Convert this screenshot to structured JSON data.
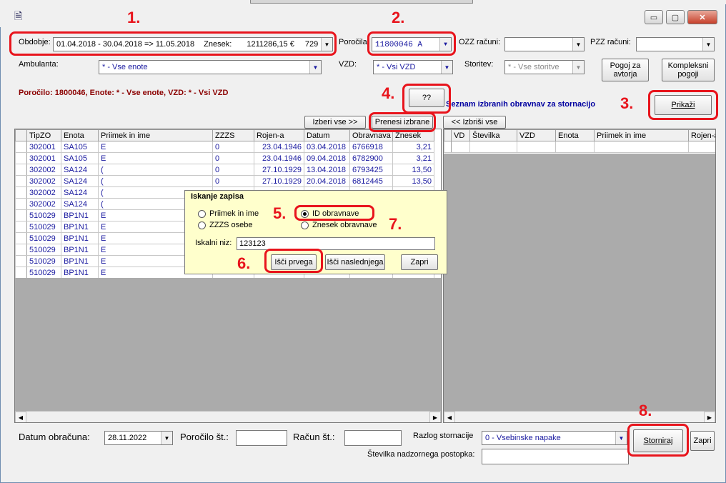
{
  "window": {
    "minimize": "▭",
    "maximize": "▢",
    "close": "✕",
    "app_icon": "report-icon"
  },
  "filters": {
    "obdobje_label": "Obdobje:",
    "obdobje_value": "01.04.2018 - 30.04.2018 => 11.05.2018",
    "znesek_label": "Znesek:",
    "znesek_value": "1211286,15 €",
    "znesek_count": "729",
    "porocilo_label": "Poročila",
    "porocilo_value": "11800046 A",
    "ozz_label": "OZZ računi:",
    "pzz_label": "PZZ računi:",
    "ambulanta_label": "Ambulanta:",
    "ambulanta_value": "*  - Vse enote",
    "vzd_label": "VZD:",
    "vzd_value": "*  - Vsi VZD",
    "storitev_label": "Storitev:",
    "storitev_value": "*  - Vse storitve",
    "pogoj_avtorja": "Pogoj za avtorja",
    "kompleksni_pogoji": "Kompleksni pogoji"
  },
  "status_text": "Poročilo: 1800046, Enote: *  - Vse enote, VZD: *  - Vsi VZD",
  "search_button": "??",
  "list_title": "Seznam  izbranih obravnav za stornacijo",
  "prikazi": "Prikaži",
  "izberi_vse": "Izberi vse >>",
  "prenesi_izbrane": "Prenesi izbrane",
  "izbrisi_vse": "<< Izbriši vse",
  "left_table": {
    "headers": [
      "TipZO",
      "Enota",
      "Priimek in ime",
      "ZZZS",
      "Rojen-a",
      "Datum",
      "Obravnava",
      "Znesek"
    ],
    "rows": [
      [
        "302001",
        "SA105",
        "E",
        "0",
        "23.04.1946",
        "03.04.2018",
        "6766918",
        "3,21"
      ],
      [
        "302001",
        "SA105",
        "E",
        "0",
        "23.04.1946",
        "09.04.2018",
        "6782900",
        "3,21"
      ],
      [
        "302002",
        "SA124",
        "(",
        "0",
        "27.10.1929",
        "13.04.2018",
        "6793425",
        "13,50"
      ],
      [
        "302002",
        "SA124",
        "(",
        "0",
        "27.10.1929",
        "20.04.2018",
        "6812445",
        "13,50"
      ],
      [
        "302002",
        "SA124",
        "(",
        "",
        "",
        "",
        "",
        ""
      ],
      [
        "302002",
        "SA124",
        "(",
        "",
        "",
        "",
        "",
        ""
      ],
      [
        "510029",
        "BP1N1",
        "E",
        "",
        "",
        "",
        "",
        ""
      ],
      [
        "510029",
        "BP1N1",
        "E",
        "",
        "",
        "",
        "",
        ""
      ],
      [
        "510029",
        "BP1N1",
        "E",
        "",
        "",
        "",
        "",
        ""
      ],
      [
        "510029",
        "BP1N1",
        "E",
        "",
        "",
        "",
        "",
        ""
      ],
      [
        "510029",
        "BP1N1",
        "E",
        "",
        "",
        "",
        "",
        ""
      ],
      [
        "510029",
        "BP1N1",
        "E",
        "",
        "",
        "",
        "",
        ""
      ]
    ]
  },
  "right_table": {
    "headers": [
      "VD",
      "Številka",
      "VZD",
      "Enota",
      "Priimek in ime",
      "Rojen-a"
    ]
  },
  "dialog": {
    "title": "Iskanje zapisa",
    "opt_priimek": "Priimek in ime",
    "opt_zzzs": "ZZZS osebe",
    "opt_id": "ID obravnave",
    "opt_znesek": "Znesek obravnave",
    "iskalni_label": "Iskalni niz:",
    "iskalni_value": "123123",
    "isci_prvega": "Išči prvega",
    "isci_naslednjega": "Išči naslednjega",
    "zapri": "Zapri"
  },
  "bottom": {
    "datum_label": "Datum obračuna:",
    "datum_value": "28.11.2022",
    "porocilo_st_label": "Poročilo št.:",
    "racun_st_label": "Račun št.:",
    "razlog_label": "Razlog stornacije",
    "razlog_value": "0 - Vsebinske napake",
    "nadzor_label": "Številka nadzornega postopka:",
    "storniraj": "Storniraj",
    "zapri": "Zapri"
  },
  "annotations": [
    "1.",
    "2.",
    "3.",
    "4.",
    "5.",
    "6.",
    "7.",
    "8."
  ]
}
